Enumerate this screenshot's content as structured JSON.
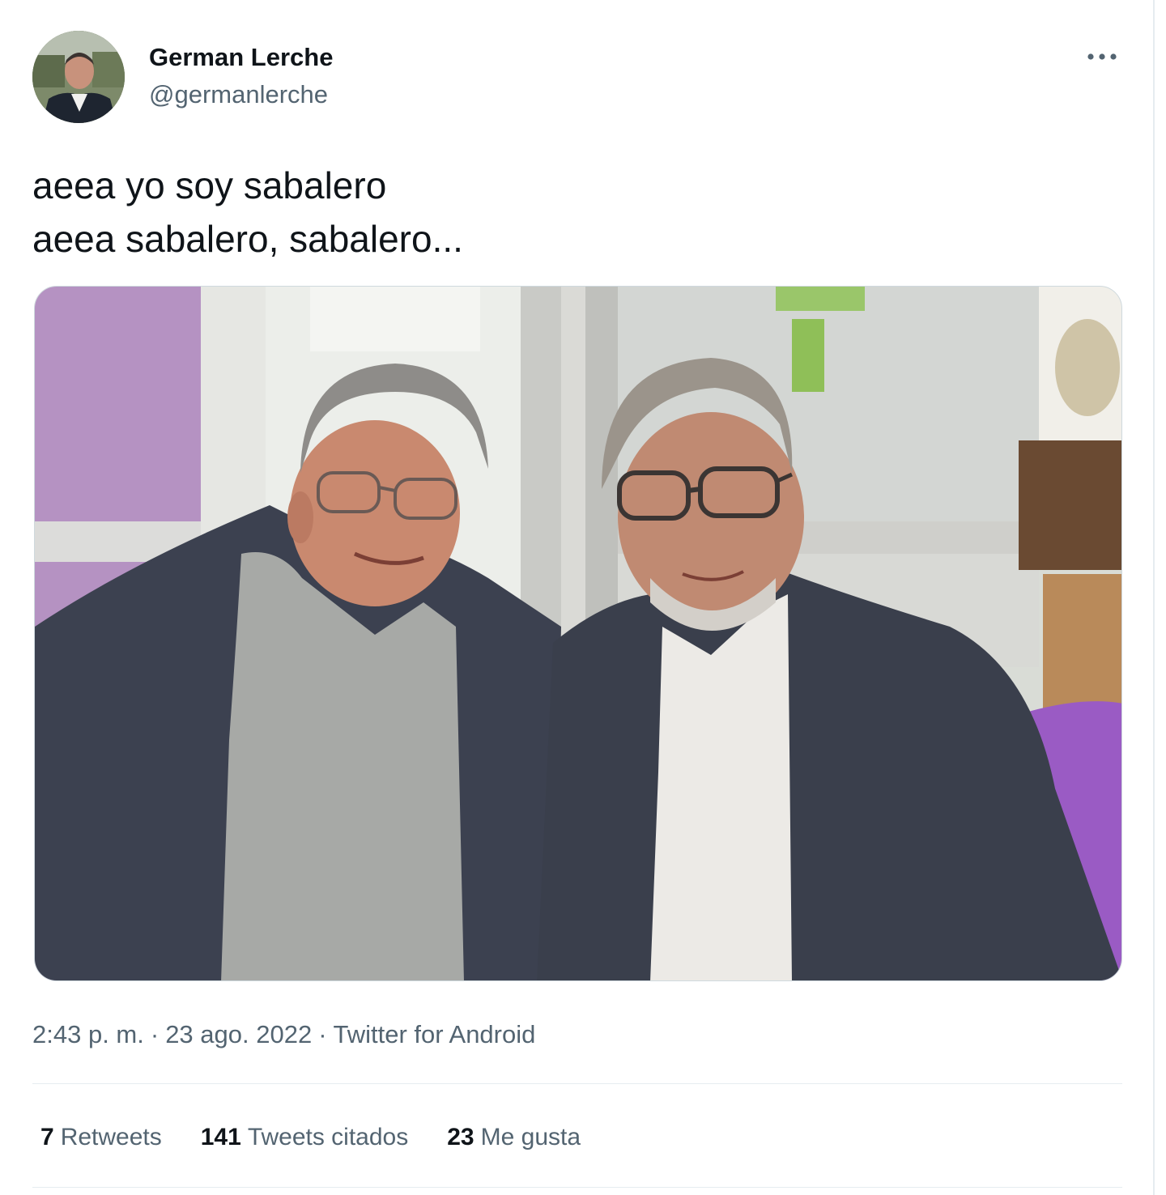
{
  "tweet": {
    "author": {
      "display_name": "German Lerche",
      "handle": "@germanlerche",
      "avatar_icon": "profile-photo"
    },
    "more_icon": "ellipsis-icon",
    "text_lines": [
      "aeea yo soy sabalero",
      "aeea sabalero, sabalero..."
    ],
    "media": {
      "type": "photo",
      "icon": "photo-two-men-sitting"
    },
    "meta": {
      "time": "2:43 p. m.",
      "date": "23 ago. 2022",
      "separator": "·",
      "source": "Twitter for Android"
    },
    "stats": {
      "retweets": {
        "count": "7",
        "label": "Retweets"
      },
      "quotes": {
        "count": "141",
        "label": "Tweets citados"
      },
      "likes": {
        "count": "23",
        "label": "Me gusta"
      }
    },
    "colors": {
      "text": "#0f1419",
      "secondary": "#536471",
      "border": "#e6ecf0"
    }
  }
}
